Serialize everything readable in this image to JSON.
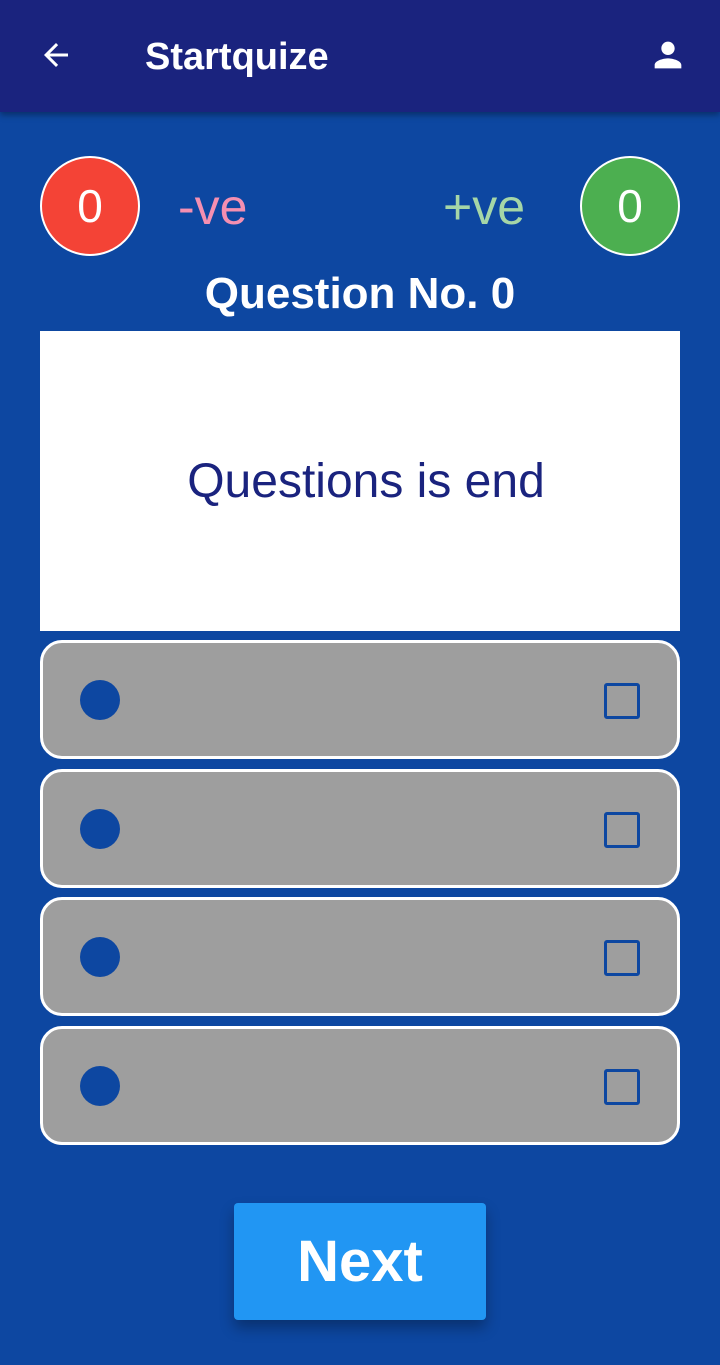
{
  "app_bar": {
    "title": "Startquize",
    "back_icon": "arrow-back-icon",
    "profile_icon": "person-icon"
  },
  "score": {
    "negative_count": "0",
    "negative_label": "-ve",
    "positive_count": "0",
    "positive_label": "+ve"
  },
  "question": {
    "number_label": "Question No. 0",
    "text": "Questions is end"
  },
  "options": [
    {
      "text": ""
    },
    {
      "text": ""
    },
    {
      "text": ""
    },
    {
      "text": ""
    }
  ],
  "next_button": {
    "label": "Next"
  },
  "colors": {
    "background": "#0d47a1",
    "app_bar": "#1a237e",
    "negative": "#f44336",
    "positive": "#4caf50",
    "option_bg": "#9e9e9e",
    "next_button": "#2196f3"
  }
}
